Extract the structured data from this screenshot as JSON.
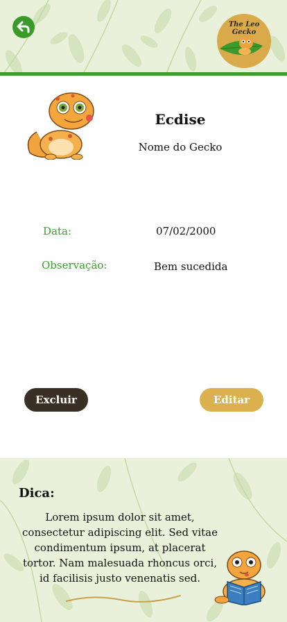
{
  "header": {
    "back_label": "Voltar",
    "logo_line1": "The Leo",
    "logo_line2": "Gecko"
  },
  "record": {
    "title": "Ecdise",
    "gecko_name": "Nome do Gecko",
    "date_label": "Data:",
    "date_value": "07/02/2000",
    "notes_label": "Observação:",
    "notes_value": "Bem sucedida"
  },
  "actions": {
    "delete_label": "Excluir",
    "edit_label": "Editar"
  },
  "tip": {
    "title": "Dica:",
    "text": "Lorem ipsum dolor sit amet, consectetur adipiscing elit. Sed vitae condimentum ipsum, at placerat tortor. Nam malesuada rhoncus orci, id facilisis justo venenatis sed."
  },
  "colors": {
    "accent_green": "#3a9b2b",
    "delete_button": "#3a2f24",
    "edit_button": "#dcb04e",
    "pattern_bg": "#e9f1da"
  },
  "icons": {
    "back": "back-arrow-icon",
    "logo": "leo-gecko-logo"
  }
}
